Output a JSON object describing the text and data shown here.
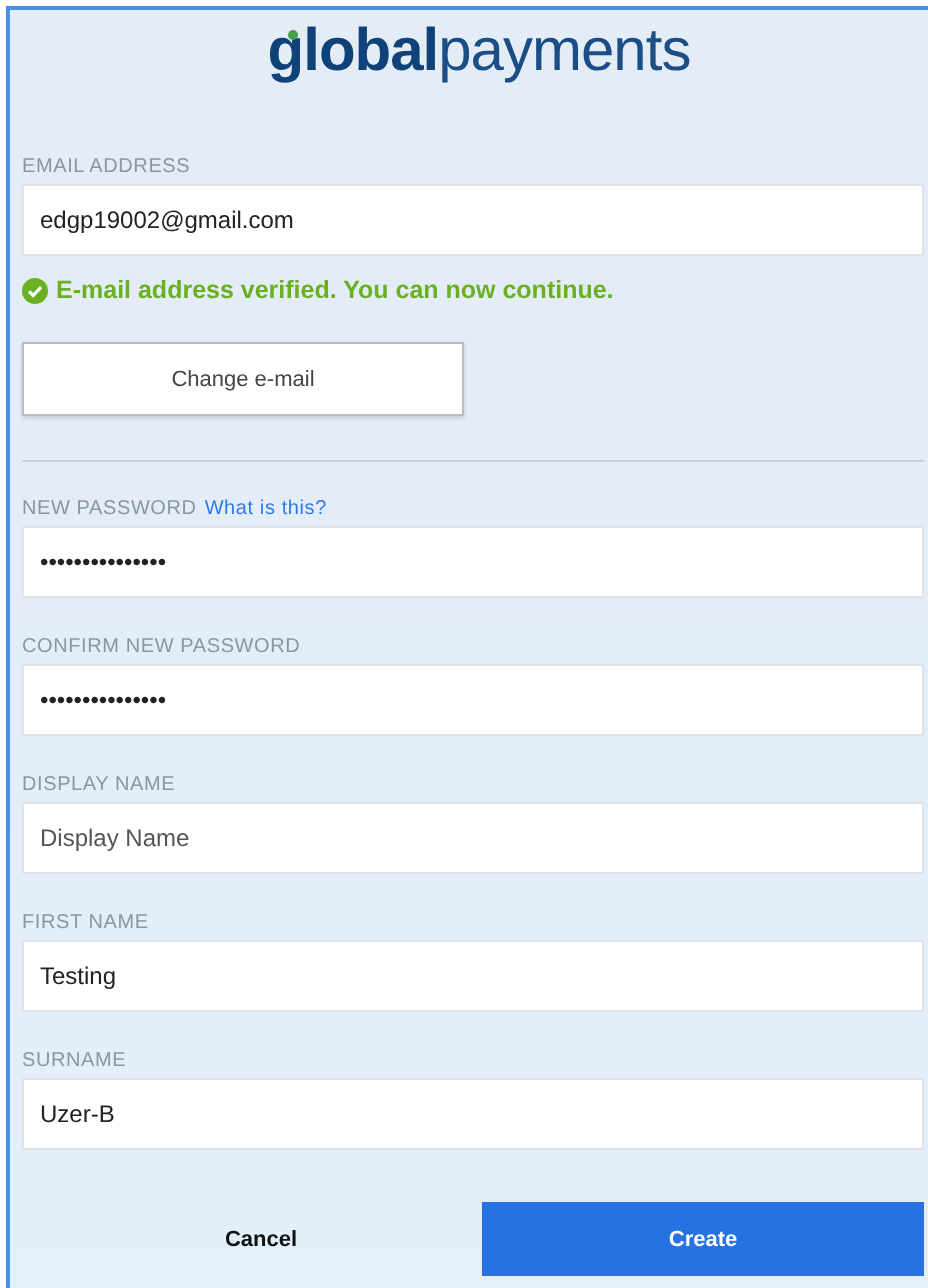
{
  "logo": {
    "bold": "global",
    "light": "payments"
  },
  "email": {
    "label": "EMAIL ADDRESS",
    "value": "edgp19002@gmail.com"
  },
  "verified_message": "E-mail address verified. You can now continue.",
  "change_email_button": "Change e-mail",
  "fields": [
    {
      "label": "NEW PASSWORD",
      "link": "What is this?",
      "value": "•••••••••••••••"
    },
    {
      "label": "CONFIRM NEW PASSWORD",
      "value": "•••••••••••••••"
    },
    {
      "label": "DISPLAY NAME",
      "placeholder": "Display Name"
    },
    {
      "label": "FIRST NAME",
      "value": "Testing"
    },
    {
      "label": "SURNAME",
      "value": "Uzer-B"
    }
  ],
  "buttons": [
    {
      "label": "Cancel",
      "kind": "plain"
    },
    {
      "label": "Create",
      "kind": "primary"
    }
  ]
}
